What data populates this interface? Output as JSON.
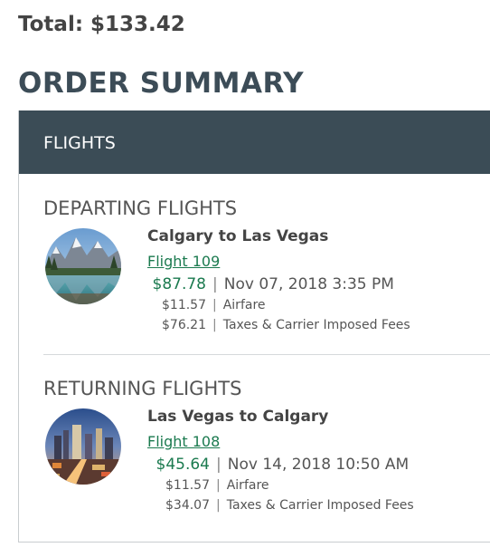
{
  "total_label": "Total: $133.42",
  "order_summary_title": "ORDER SUMMARY",
  "panel_title": "FLIGHTS",
  "separator": "|",
  "departing": {
    "heading": "DEPARTING FLIGHTS",
    "route": "Calgary to Las Vegas",
    "flight_link": "Flight 109",
    "price": "$87.78",
    "datetime": "Nov 07, 2018 3:35 PM",
    "airfare_amount": "$11.57",
    "airfare_label": "Airfare",
    "taxes_amount": "$76.21",
    "taxes_label": "Taxes & Carrier Imposed Fees",
    "image_icon": "mountain-lake-thumbnail"
  },
  "returning": {
    "heading": "RETURNING FLIGHTS",
    "route": "Las Vegas to Calgary",
    "flight_link": "Flight 108",
    "price": "$45.64",
    "datetime": "Nov 14, 2018 10:50 AM",
    "airfare_amount": "$11.57",
    "airfare_label": "Airfare",
    "taxes_amount": "$34.07",
    "taxes_label": "Taxes & Carrier Imposed Fees",
    "image_icon": "las-vegas-strip-thumbnail"
  },
  "colors": {
    "header_bg": "#3b4c56",
    "title_text": "#3c4c57",
    "price_green": "#1b7a4f"
  }
}
